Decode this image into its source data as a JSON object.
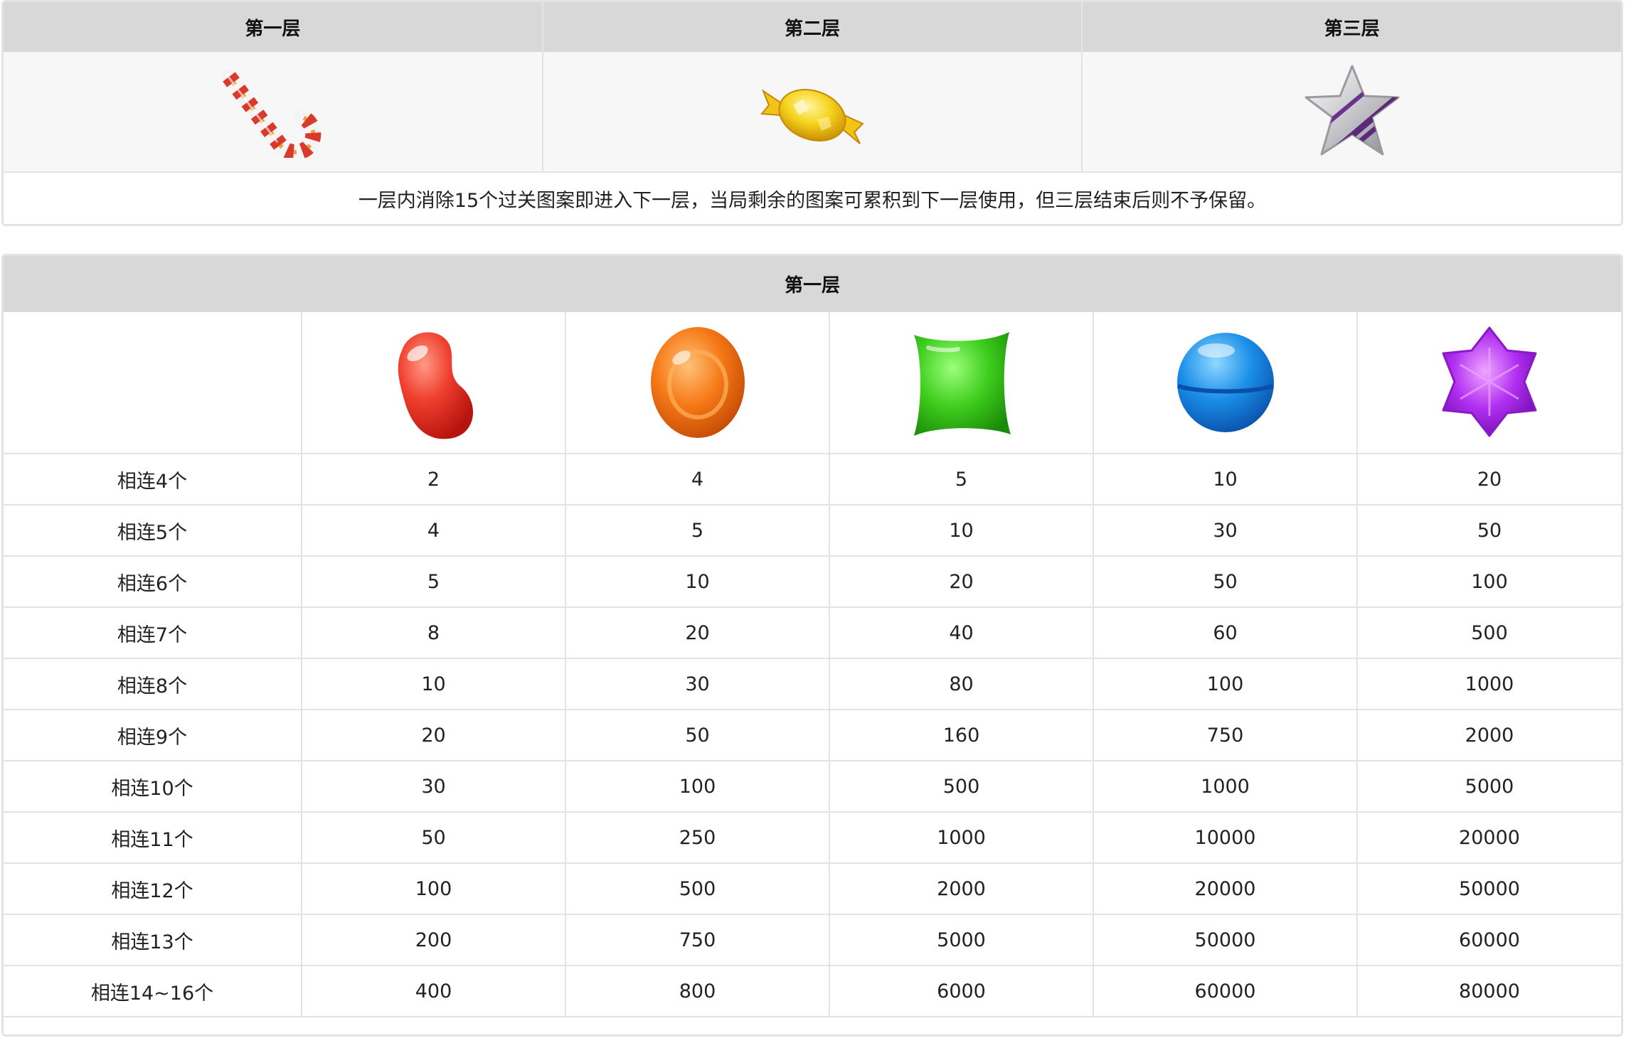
{
  "levels": {
    "headers": [
      "第一层",
      "第二层",
      "第三层"
    ],
    "icons": [
      "candy-cane-icon",
      "wrapped-yellow-candy-icon",
      "striped-star-candy-icon"
    ],
    "note": "一层内消除15个过关图案即进入下一层，当局剩余的图案可累积到下一层使用，但三层结束后则不予保留。"
  },
  "payout": {
    "title": "第一层",
    "symbols": [
      "red-jellybean-icon",
      "orange-round-candy-icon",
      "green-square-candy-icon",
      "blue-ball-candy-icon",
      "purple-hexagon-candy-icon"
    ],
    "rows": [
      {
        "label": "相连4个",
        "values": [
          "2",
          "4",
          "5",
          "10",
          "20"
        ]
      },
      {
        "label": "相连5个",
        "values": [
          "4",
          "5",
          "10",
          "30",
          "50"
        ]
      },
      {
        "label": "相连6个",
        "values": [
          "5",
          "10",
          "20",
          "50",
          "100"
        ]
      },
      {
        "label": "相连7个",
        "values": [
          "8",
          "20",
          "40",
          "60",
          "500"
        ]
      },
      {
        "label": "相连8个",
        "values": [
          "10",
          "30",
          "80",
          "100",
          "1000"
        ]
      },
      {
        "label": "相连9个",
        "values": [
          "20",
          "50",
          "160",
          "750",
          "2000"
        ]
      },
      {
        "label": "相连10个",
        "values": [
          "30",
          "100",
          "500",
          "1000",
          "5000"
        ]
      },
      {
        "label": "相连11个",
        "values": [
          "50",
          "250",
          "1000",
          "10000",
          "20000"
        ]
      },
      {
        "label": "相连12个",
        "values": [
          "100",
          "500",
          "2000",
          "20000",
          "50000"
        ]
      },
      {
        "label": "相连13个",
        "values": [
          "200",
          "750",
          "5000",
          "50000",
          "60000"
        ]
      },
      {
        "label": "相连14~16个",
        "values": [
          "400",
          "800",
          "6000",
          "60000",
          "80000"
        ]
      }
    ]
  },
  "colors": {
    "header_bg": "#d8d8d8",
    "icon_row_bg": "#f7f7f7",
    "border": "#e3e3e3"
  }
}
